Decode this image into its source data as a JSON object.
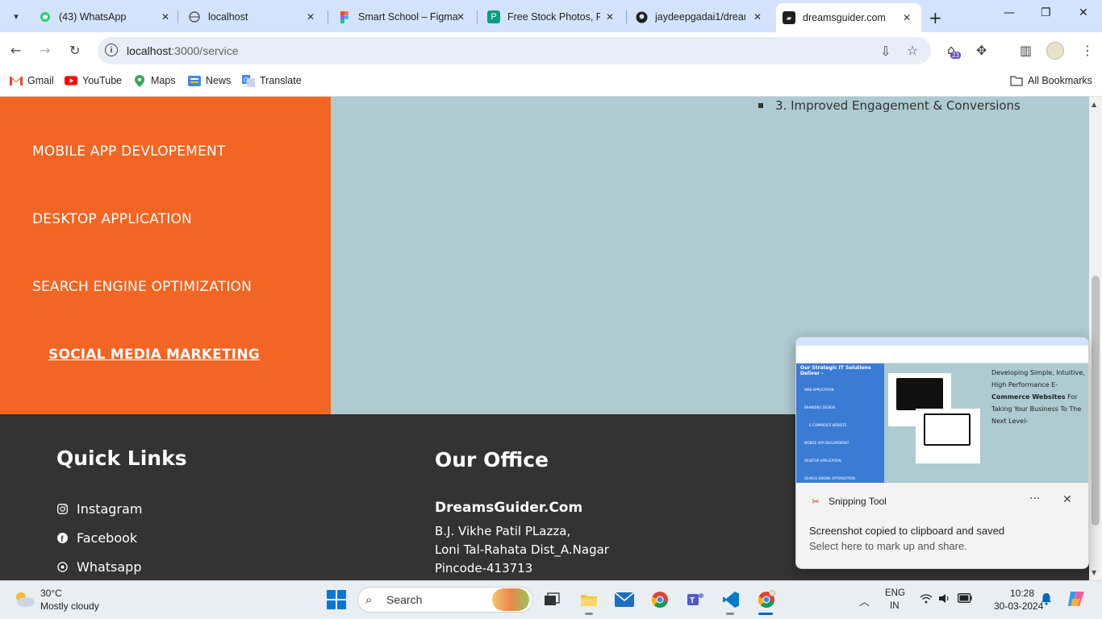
{
  "browser": {
    "tabs": [
      {
        "label": "(43) WhatsApp",
        "icon": "whatsapp-icon"
      },
      {
        "label": "localhost",
        "icon": "globe-icon"
      },
      {
        "label": "Smart School – Figma",
        "icon": "figma-icon"
      },
      {
        "label": "Free Stock Photos, Ro",
        "icon": "pexels-icon"
      },
      {
        "label": "jaydeepgadai1/dream",
        "icon": "github-icon"
      },
      {
        "label": "dreamsguider.com",
        "icon": "site-icon"
      }
    ],
    "url_host": "localhost",
    "url_path": ":3000/service",
    "extension_badge": "23",
    "bookmarks": [
      "Gmail",
      "YouTube",
      "Maps",
      "News",
      "Translate"
    ],
    "all_bookmarks": "All Bookmarks"
  },
  "services": {
    "items": [
      "MOBILE APP DEVLOPEMENT",
      "DESKTOP APPLICATION",
      "SEARCH ENGINE OPTIMIZATION",
      "SOCIAL MEDIA MARKETING"
    ],
    "active_index": 3,
    "benefit": "3. Improved Engagement & Conversions"
  },
  "footer": {
    "quick_links_title": "Quick Links",
    "links": [
      "Instagram",
      "Facebook",
      "Whatsapp"
    ],
    "office_title": "Our Office",
    "office_name": "DreamsGuider.Com",
    "address": [
      "B.J. Vikhe Patil PLazza,",
      "Loni Tal-Rahata Dist_A.Nagar",
      "Pincode-413713"
    ]
  },
  "toast": {
    "app": "Snipping Tool",
    "message": "Screenshot copied to clipboard and saved",
    "sub": "Select here to mark up and share.",
    "thumb_title": "Our Strategic IT Solutions Deliver -",
    "thumb_items": [
      "WEB APPLICATION",
      "BRANDING DESIGN",
      "E-COMMERCE WEBSITE",
      "MOBILE APP DEVLOPEMENT",
      "DESKTOP APPLICATION",
      "SEARCH ENGINE OPTIMIZATION"
    ],
    "thumb_text_a": "Developing Simple, Intuitive, High Performance E-",
    "thumb_text_b": "Commerce Websites",
    "thumb_text_c": "For Taking Your Business To The Next Level-"
  },
  "taskbar": {
    "temp": "30°C",
    "weather": "Mostly cloudy",
    "search": "Search",
    "lang1": "ENG",
    "lang2": "IN",
    "time": "10:28",
    "date": "30-03-2024"
  }
}
